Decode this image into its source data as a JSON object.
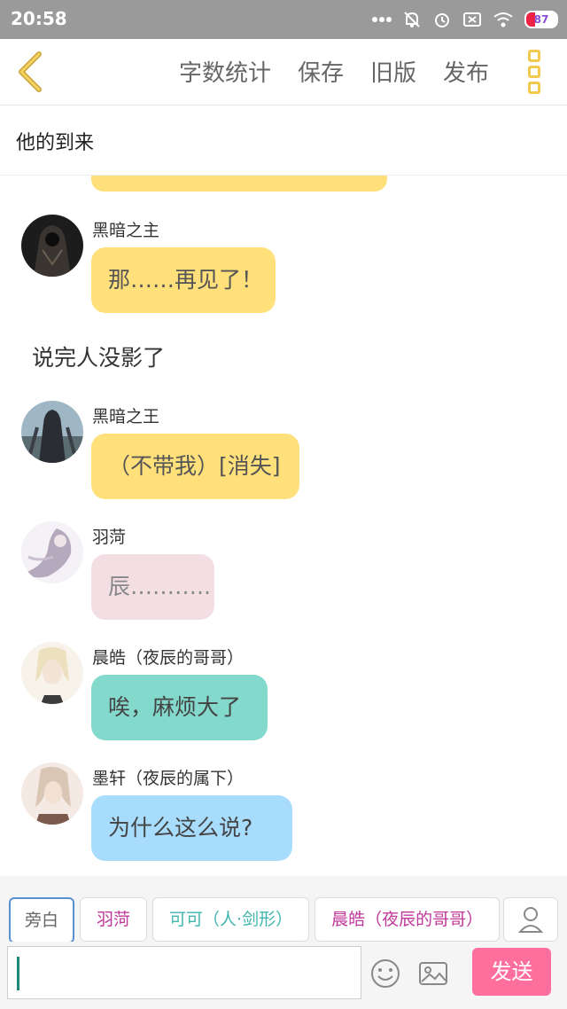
{
  "status": {
    "time": "20:58",
    "battery": "87"
  },
  "toolbar": {
    "actions": [
      "字数统计",
      "保存",
      "旧版",
      "发布"
    ]
  },
  "title": "他的到来",
  "messages": [
    {
      "name": "黑暗之主",
      "text": "那……再见了！",
      "bubble_color": "#ffe07a"
    },
    {
      "narration": "说完人没影了"
    },
    {
      "name": "黑暗之王",
      "text": "（不带我）[消失]",
      "bubble_color": "#ffe07a"
    },
    {
      "name": "羽菏",
      "text": "辰………..",
      "bubble_color": "#f3dfe3"
    },
    {
      "name": "晨皓（夜辰的哥哥）",
      "text": "唉，麻烦大了",
      "bubble_color": "#84d9cd"
    },
    {
      "name": "墨轩（夜辰的属下）",
      "text": "为什么这么说?",
      "bubble_color": "#a7dcfd"
    }
  ],
  "chips": [
    "旁白",
    "羽菏",
    "可可（人·剑形）",
    "晨皓（夜辰的哥哥）"
  ],
  "input": {
    "value": ""
  },
  "send_label": "发送",
  "colors": {
    "accent_pink": "#ff6f9e",
    "yellow_bubble": "#ffe07a",
    "toolbar_icon": "#f2c94c"
  }
}
